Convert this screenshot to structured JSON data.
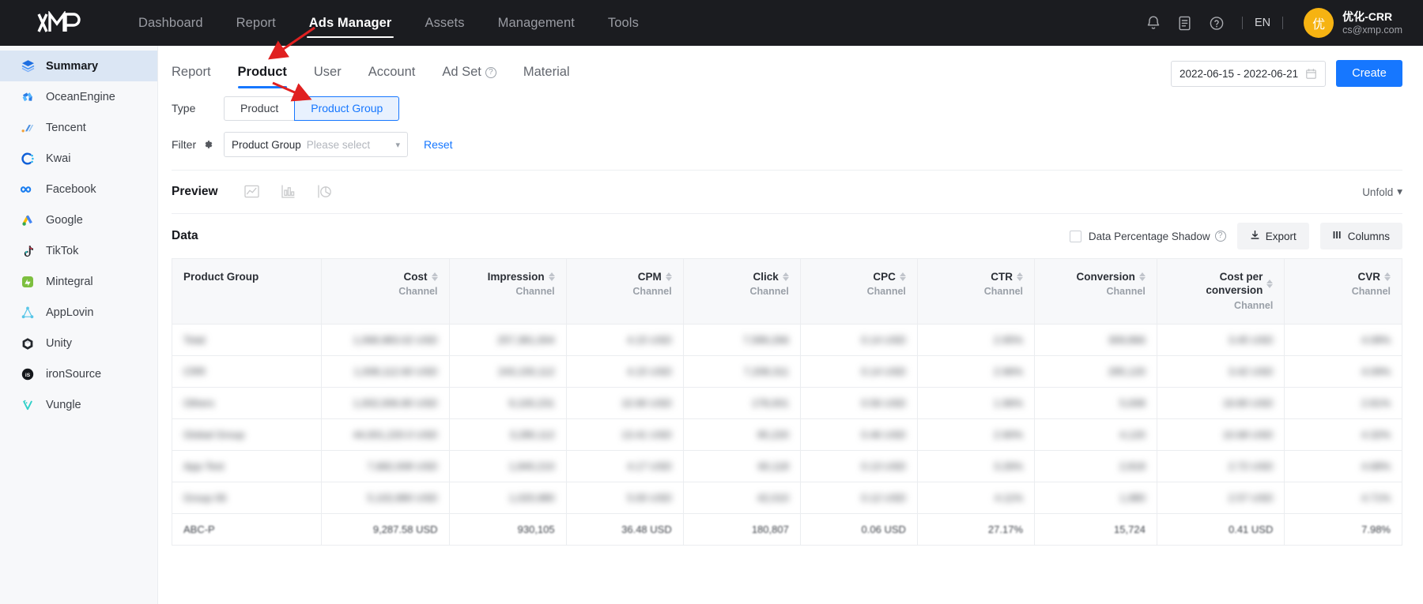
{
  "header": {
    "logo_alt": "XMP",
    "nav": [
      {
        "label": "Dashboard",
        "active": false
      },
      {
        "label": "Report",
        "active": false
      },
      {
        "label": "Ads Manager",
        "active": true
      },
      {
        "label": "Assets",
        "active": false
      },
      {
        "label": "Management",
        "active": false
      },
      {
        "label": "Tools",
        "active": false
      }
    ],
    "icons": [
      "bell-icon",
      "document-icon",
      "help-icon"
    ],
    "language": "EN",
    "user": {
      "avatar_initial": "优",
      "name": "优化-CRR",
      "email": "cs@xmp.com",
      "avatar_color": "#f6b312"
    }
  },
  "sidebar": {
    "items": [
      {
        "label": "Summary",
        "icon": "layers-icon",
        "active": true
      },
      {
        "label": "OceanEngine",
        "icon": "oceanengine-icon",
        "active": false
      },
      {
        "label": "Tencent",
        "icon": "tencent-icon",
        "active": false
      },
      {
        "label": "Kwai",
        "icon": "kwai-icon",
        "active": false
      },
      {
        "label": "Facebook",
        "icon": "facebook-icon",
        "active": false
      },
      {
        "label": "Google",
        "icon": "google-ads-icon",
        "active": false
      },
      {
        "label": "TikTok",
        "icon": "tiktok-icon",
        "active": false
      },
      {
        "label": "Mintegral",
        "icon": "mintegral-icon",
        "active": false
      },
      {
        "label": "AppLovin",
        "icon": "applovin-icon",
        "active": false
      },
      {
        "label": "Unity",
        "icon": "unity-icon",
        "active": false
      },
      {
        "label": "ironSource",
        "icon": "ironsource-icon",
        "active": false
      },
      {
        "label": "Vungle",
        "icon": "vungle-icon",
        "active": false
      }
    ]
  },
  "tabs": [
    {
      "label": "Report",
      "active": false,
      "help": false
    },
    {
      "label": "Product",
      "active": true,
      "help": false
    },
    {
      "label": "User",
      "active": false,
      "help": false
    },
    {
      "label": "Account",
      "active": false,
      "help": false
    },
    {
      "label": "Ad Set",
      "active": false,
      "help": true
    },
    {
      "label": "Material",
      "active": false,
      "help": false
    }
  ],
  "toolbar": {
    "date_range": "2022-06-15 - 2022-06-21",
    "create_label": "Create"
  },
  "filters": {
    "type_label": "Type",
    "type_options": [
      {
        "label": "Product",
        "selected": false
      },
      {
        "label": "Product Group",
        "selected": true
      }
    ],
    "filter_label": "Filter",
    "select_label": "Product Group",
    "select_placeholder": "Please select",
    "reset_label": "Reset"
  },
  "preview": {
    "title": "Preview",
    "icons": [
      "line-chart-icon",
      "bar-chart-icon",
      "pie-chart-icon"
    ],
    "unfold_label": "Unfold"
  },
  "data_section": {
    "title": "Data",
    "percentage_shadow_label": "Data Percentage Shadow",
    "percentage_shadow_checked": false,
    "export_label": "Export",
    "columns_label": "Columns"
  },
  "table": {
    "columns": [
      {
        "title": "Product Group",
        "sub": "",
        "sortable": false,
        "align": "left"
      },
      {
        "title": "Cost",
        "sub": "Channel",
        "sortable": true,
        "align": "right"
      },
      {
        "title": "Impression",
        "sub": "Channel",
        "sortable": true,
        "align": "right"
      },
      {
        "title": "CPM",
        "sub": "Channel",
        "sortable": true,
        "align": "right"
      },
      {
        "title": "Click",
        "sub": "Channel",
        "sortable": true,
        "align": "right"
      },
      {
        "title": "CPC",
        "sub": "Channel",
        "sortable": true,
        "align": "right"
      },
      {
        "title": "CTR",
        "sub": "Channel",
        "sortable": true,
        "align": "right"
      },
      {
        "title": "Conversion",
        "sub": "Channel",
        "sortable": true,
        "align": "right"
      },
      {
        "title": "Cost per conversion",
        "sub": "Channel",
        "sortable": true,
        "align": "right"
      },
      {
        "title": "CVR",
        "sub": "Channel",
        "sortable": true,
        "align": "right"
      }
    ],
    "rows": [
      {
        "blurred": true,
        "cells": [
          "Total",
          "1,068,983.02 USD",
          "257,381,004",
          "4.15 USD",
          "7,589,266",
          "0.14 USD",
          "2.95%",
          "309,866",
          "3.45 USD",
          "4.08%"
        ]
      },
      {
        "blurred": true,
        "cells": [
          "CRR",
          "1,008,112.60 USD",
          "243,150,112",
          "4.15 USD",
          "7,208,311",
          "0.14 USD",
          "2.96%",
          "295,120",
          "3.42 USD",
          "4.09%"
        ]
      },
      {
        "blurred": true,
        "cells": [
          "Others",
          "1,002,006.80 USD",
          "9,100,231",
          "10.90 USD",
          "178,001",
          "0.56 USD",
          "1.96%",
          "5,008",
          "19.80 USD",
          "2.81%"
        ]
      },
      {
        "blurred": true,
        "cells": [
          "Global Group",
          "44,001,220.0 USD",
          "3,280,112",
          "13.41 USD",
          "95,220",
          "0.46 USD",
          "2.90%",
          "4,120",
          "10.68 USD",
          "4.32%"
        ]
      },
      {
        "blurred": true,
        "cells": [
          "App-Test",
          "7,682,008 USD",
          "1,840,210",
          "4.17 USD",
          "60,118",
          "0.13 USD",
          "3.26%",
          "2,818",
          "2.72 USD",
          "4.68%"
        ]
      },
      {
        "blurred": true,
        "cells": [
          "Group 06",
          "5,102,880 USD",
          "1,020,980",
          "5.00 USD",
          "42,010",
          "0.12 USD",
          "4.11%",
          "1,980",
          "2.57 USD",
          "4.71%"
        ]
      },
      {
        "blurred": false,
        "cells": [
          "ABC-P",
          "9,287.58 USD",
          "930,105",
          "36.48 USD",
          "180,807",
          "0.06 USD",
          "27.17%",
          "15,724",
          "0.41 USD",
          "7.98%"
        ]
      }
    ]
  },
  "annotations": {
    "arrows": [
      {
        "name": "arrow-to-product-tab"
      },
      {
        "name": "arrow-to-product-group-button"
      }
    ],
    "color": "#e02020"
  }
}
